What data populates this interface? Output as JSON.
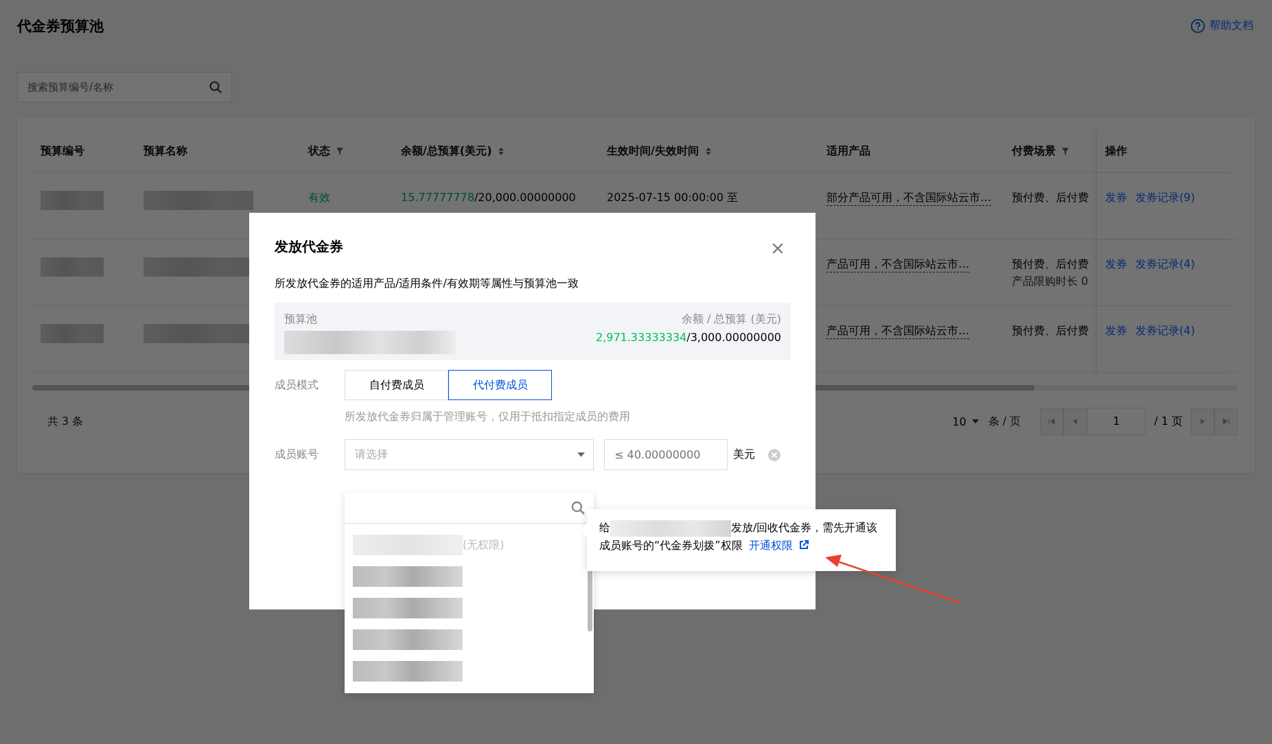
{
  "page": {
    "title": "代金券预算池",
    "help_link": "帮助文档"
  },
  "search": {
    "placeholder": "搜索预算编号/名称"
  },
  "table": {
    "columns": [
      {
        "label": "预算编号",
        "kind": "plain"
      },
      {
        "label": "预算名称",
        "kind": "plain"
      },
      {
        "label": "状态",
        "kind": "filter"
      },
      {
        "label": "余额/总预算(美元)",
        "kind": "sort"
      },
      {
        "label": "生效时间/失效时间",
        "kind": "sort"
      },
      {
        "label": "适用产品",
        "kind": "plain"
      },
      {
        "label": "付费场景",
        "kind": "filter"
      },
      {
        "label": "操作",
        "kind": "plain"
      }
    ],
    "rows": [
      {
        "status": "有效",
        "balance": "15.77777778",
        "total": "/20,000.00000000",
        "period": "2025-07-15 00:00:00 至",
        "products": "部分产品可用，不含国际站云市…",
        "payment": "预付费、后付费",
        "actions": [
          "发券",
          "发券记录(9)"
        ]
      },
      {
        "products": "产品可用，不含国际站云市…",
        "payment": "预付费、后付费",
        "payment_note": "产品限购时长 0",
        "actions": [
          "发券",
          "发券记录(4)"
        ]
      },
      {
        "products": "产品可用，不含国际站云市…",
        "payment": "预付费、后付费",
        "actions": [
          "发券",
          "发券记录(4)"
        ]
      }
    ]
  },
  "pagination": {
    "total": "共 3 条",
    "page_size": "10",
    "page_size_unit": "条 / 页",
    "page": "1",
    "page_total": "/ 1 页"
  },
  "modal": {
    "title": "发放代金券",
    "description": "所发放代金券的适用产品/适用条件/有效期等属性与预算池一致",
    "pool": {
      "label": "预算池",
      "amount_label": "余额 / 总预算 (美元)",
      "balance": "2,971.33333334",
      "total": "/3,000.00000000"
    },
    "member_mode": {
      "label": "成员模式",
      "options": [
        {
          "label": "自付费成员",
          "selected": false
        },
        {
          "label": "代付费成员",
          "selected": true
        }
      ],
      "hint": "所发放代金券归属于管理账号，仅用于抵扣指定成员的费用"
    },
    "member_account": {
      "label": "成员账号",
      "placeholder": "请选择",
      "amount_placeholder": "≤ 40.00000000",
      "unit": "美元"
    }
  },
  "dropdown": {
    "items": [
      {
        "note": "(无权限)",
        "disabled": true
      },
      {
        "disabled": false
      },
      {
        "disabled": false
      },
      {
        "disabled": false
      },
      {
        "disabled": false
      }
    ]
  },
  "tooltip": {
    "before": "给",
    "after": "发放/回收代金券，需先开通该成员账号的“代金券划拨”权限",
    "link": "开通权限"
  }
}
